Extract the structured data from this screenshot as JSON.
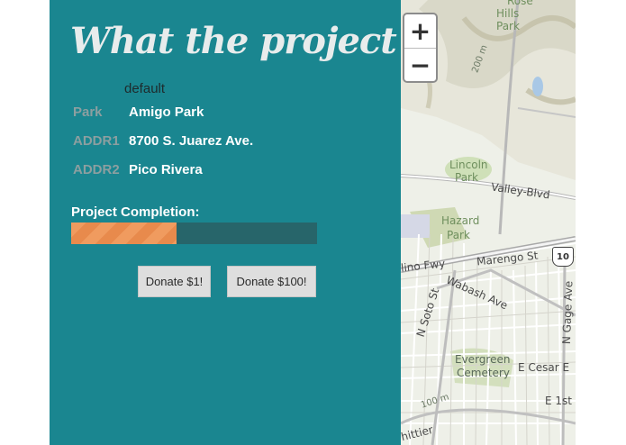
{
  "title": "What the project",
  "layer_label": "default",
  "fields": [
    {
      "key": "Park",
      "value": "Amigo Park"
    },
    {
      "key": "ADDR1",
      "value": "8700 S. Juarez Ave."
    },
    {
      "key": "ADDR2",
      "value": "Pico Rivera"
    }
  ],
  "completion": {
    "label": "Project Completion:",
    "fraction": 0.43
  },
  "buttons": {
    "donate_small": "Donate $1!",
    "donate_large": "Donate $100!"
  },
  "map": {
    "zoom_in": "+",
    "zoom_out": "−",
    "labels": {
      "rose_hills_1": "Rose",
      "rose_hills_2": "Hills",
      "rose_hills_3": "Park",
      "contour_200m": "200 m",
      "lincoln_1": "Lincoln",
      "lincoln_2": "Park",
      "valley_blvd": "Valley-Blvd",
      "hazard_1": "Hazard",
      "hazard_2": "Park",
      "route_10": "10",
      "marengo": "Marengo St",
      "valley_fwy": "lino Fwy",
      "wabash": "Wabash Ave",
      "n_soto": "N Soto St",
      "n_gage": "N Gage Ave",
      "evergreen_1": "Evergreen",
      "evergreen_2": "Cemetery",
      "e_cesar": "E Cesar E",
      "contour_100m": "100 m",
      "e_1st": "E 1st",
      "whittier": "hittier"
    }
  }
}
